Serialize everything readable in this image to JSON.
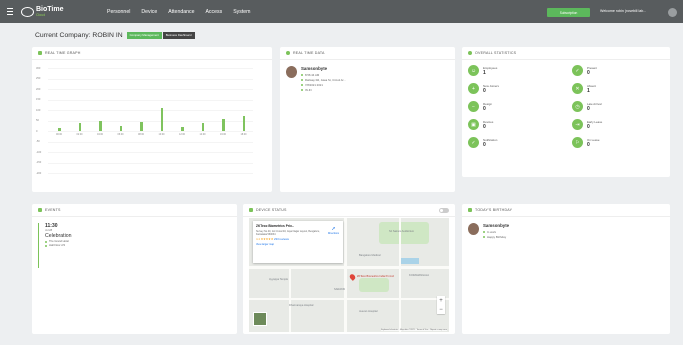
{
  "nav": {
    "logo_title": "BioTime",
    "logo_subtitle": "Cloud",
    "menu": [
      "Personnel",
      "Device",
      "Attendance",
      "Access",
      "System"
    ],
    "subscribe_label": "Subscription",
    "welcome_text": "Welcome robin (rosebill lab..."
  },
  "company": {
    "title": "Current Company: ROBIN IN",
    "btn_primary": "Company Management",
    "btn_secondary": "Business Dashboard"
  },
  "graph": {
    "title": "REAL TIME GRAPH",
    "y_ticks": [
      "300",
      "250",
      "200",
      "150",
      "100",
      "50",
      "0",
      "-50",
      "-100",
      "-150",
      "-200"
    ]
  },
  "chart_data": {
    "type": "bar",
    "title": "REAL TIME GRAPH",
    "categories": [
      "00:00",
      "02:00",
      "04:00",
      "06:00",
      "08:00",
      "10:00",
      "12:00",
      "14:00",
      "16:00",
      "18:00"
    ],
    "values": [
      16,
      38,
      50,
      26,
      42,
      110,
      20,
      38,
      56,
      73
    ]
  },
  "realtime": {
    "title": "REAL TIME DATA",
    "name": "Samsonbyte",
    "lines": [
      "8:56:44 AM",
      "Railway Rd, Jawa St, Circuit Ar...",
      "7/8/2021 2021",
      "IN-IN"
    ]
  },
  "stats": {
    "title": "OVERALL STATISTICS",
    "items": [
      {
        "label": "Employees",
        "value": "1"
      },
      {
        "label": "Present",
        "value": "0"
      },
      {
        "label": "New Joiners",
        "value": "0"
      },
      {
        "label": "Absent",
        "value": "1"
      },
      {
        "label": "Resign",
        "value": "0"
      },
      {
        "label": "Late Arrival",
        "value": "0"
      },
      {
        "label": "Devices",
        "value": "0"
      },
      {
        "label": "Early Leave",
        "value": "0"
      },
      {
        "label": "Notification",
        "value": "0"
      },
      {
        "label": "On Leave",
        "value": "0"
      }
    ]
  },
  "events": {
    "title": "EVENTS",
    "time": "11:30",
    "date": "Jul 28",
    "name": "Celebration",
    "location": "The Grand Hotel",
    "room": "Hall Floor 2/3"
  },
  "device_status": {
    "title": "DEVICE STATUS",
    "map": {
      "popup_title": "ZKTeco Biometrics Priv...",
      "popup_address": "Survey No 40, 1st Cross Rd, Jaya Nagar Layout, Bengaluru, Karnataka 560034",
      "popup_rating": "4.4 ★★★★★",
      "popup_reviews": "233 reviews",
      "popup_link": "View larger map",
      "directions_label": "Directions",
      "pin_label": "ZKTeco Biometrics India Pvt Ltd",
      "place_1": "Sri Sairam Auditorium",
      "place_2": "Bangalore Medical",
      "place_3": "Ayyappa Temple",
      "place_4": "Dharmaraya Hospital",
      "place_5": "Jeevan Hospital",
      "area_1": "KORAMANGALA",
      "area_2": "SARAKKI",
      "footer": "Keyboard shortcuts · Map data ©2021 · Terms of Use · Report a map error"
    }
  },
  "birthday": {
    "title": "TODAY'S BIRTHDAY",
    "name": "Samsonbyte",
    "line1": "In work",
    "line2": "Happy Birthday"
  }
}
